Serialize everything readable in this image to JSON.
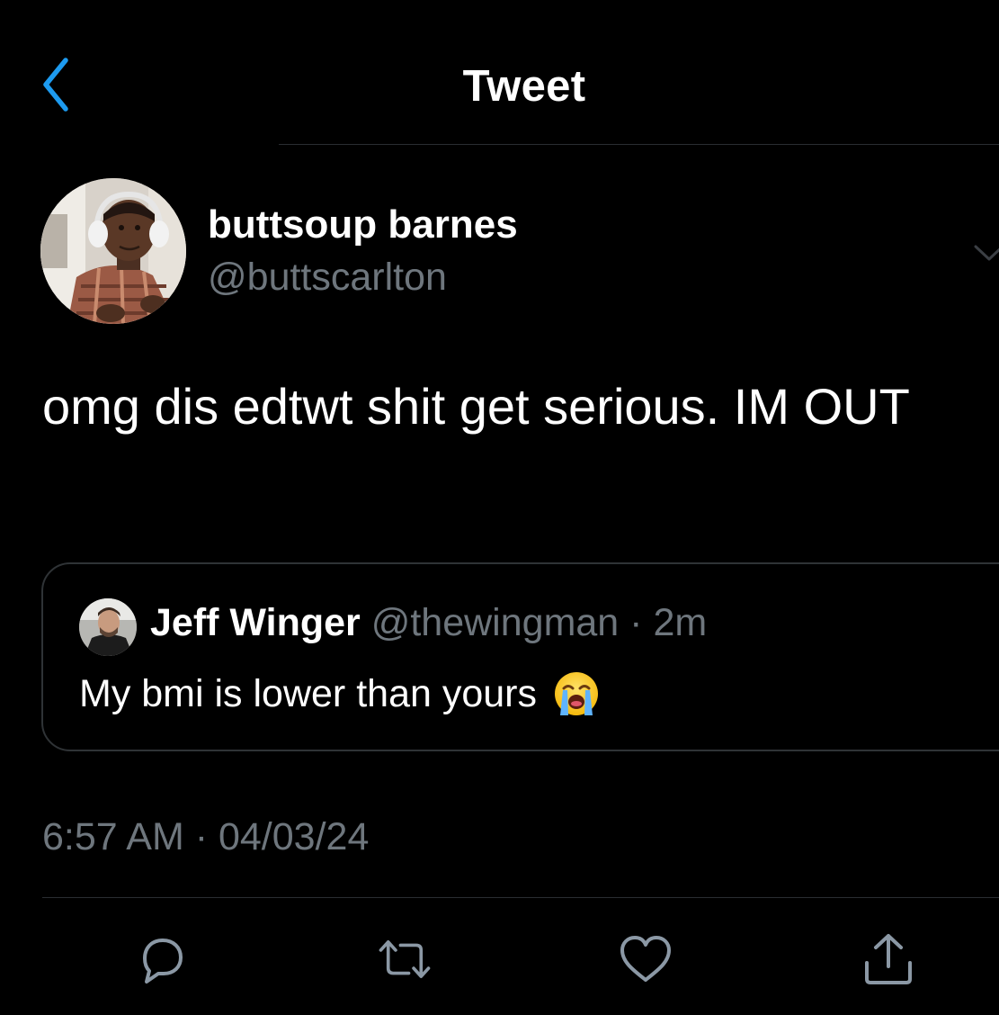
{
  "header": {
    "title": "Tweet"
  },
  "tweet": {
    "author": {
      "display_name": "buttsoup barnes",
      "handle": "@buttscarlton"
    },
    "text": "omg dis edtwt shit get serious. IM OUT",
    "timestamp": "6:57 AM · 04/03/24"
  },
  "quoted_tweet": {
    "display_name": "Jeff Winger",
    "handle": "@thewingman",
    "separator": " · ",
    "age": "2m",
    "text": "My bmi is lower than yours"
  },
  "icons": {
    "back": "chevron-left-icon",
    "more": "chevron-down-icon",
    "reply": "reply-icon",
    "retweet": "retweet-icon",
    "like": "heart-icon",
    "share": "share-icon",
    "emoji": "loudly-crying-face-emoji"
  },
  "colors": {
    "background": "#000000",
    "primary_text": "#ffffff",
    "secondary_text": "#6e767d",
    "accent": "#1d9bf0",
    "border": "#2f3336"
  }
}
